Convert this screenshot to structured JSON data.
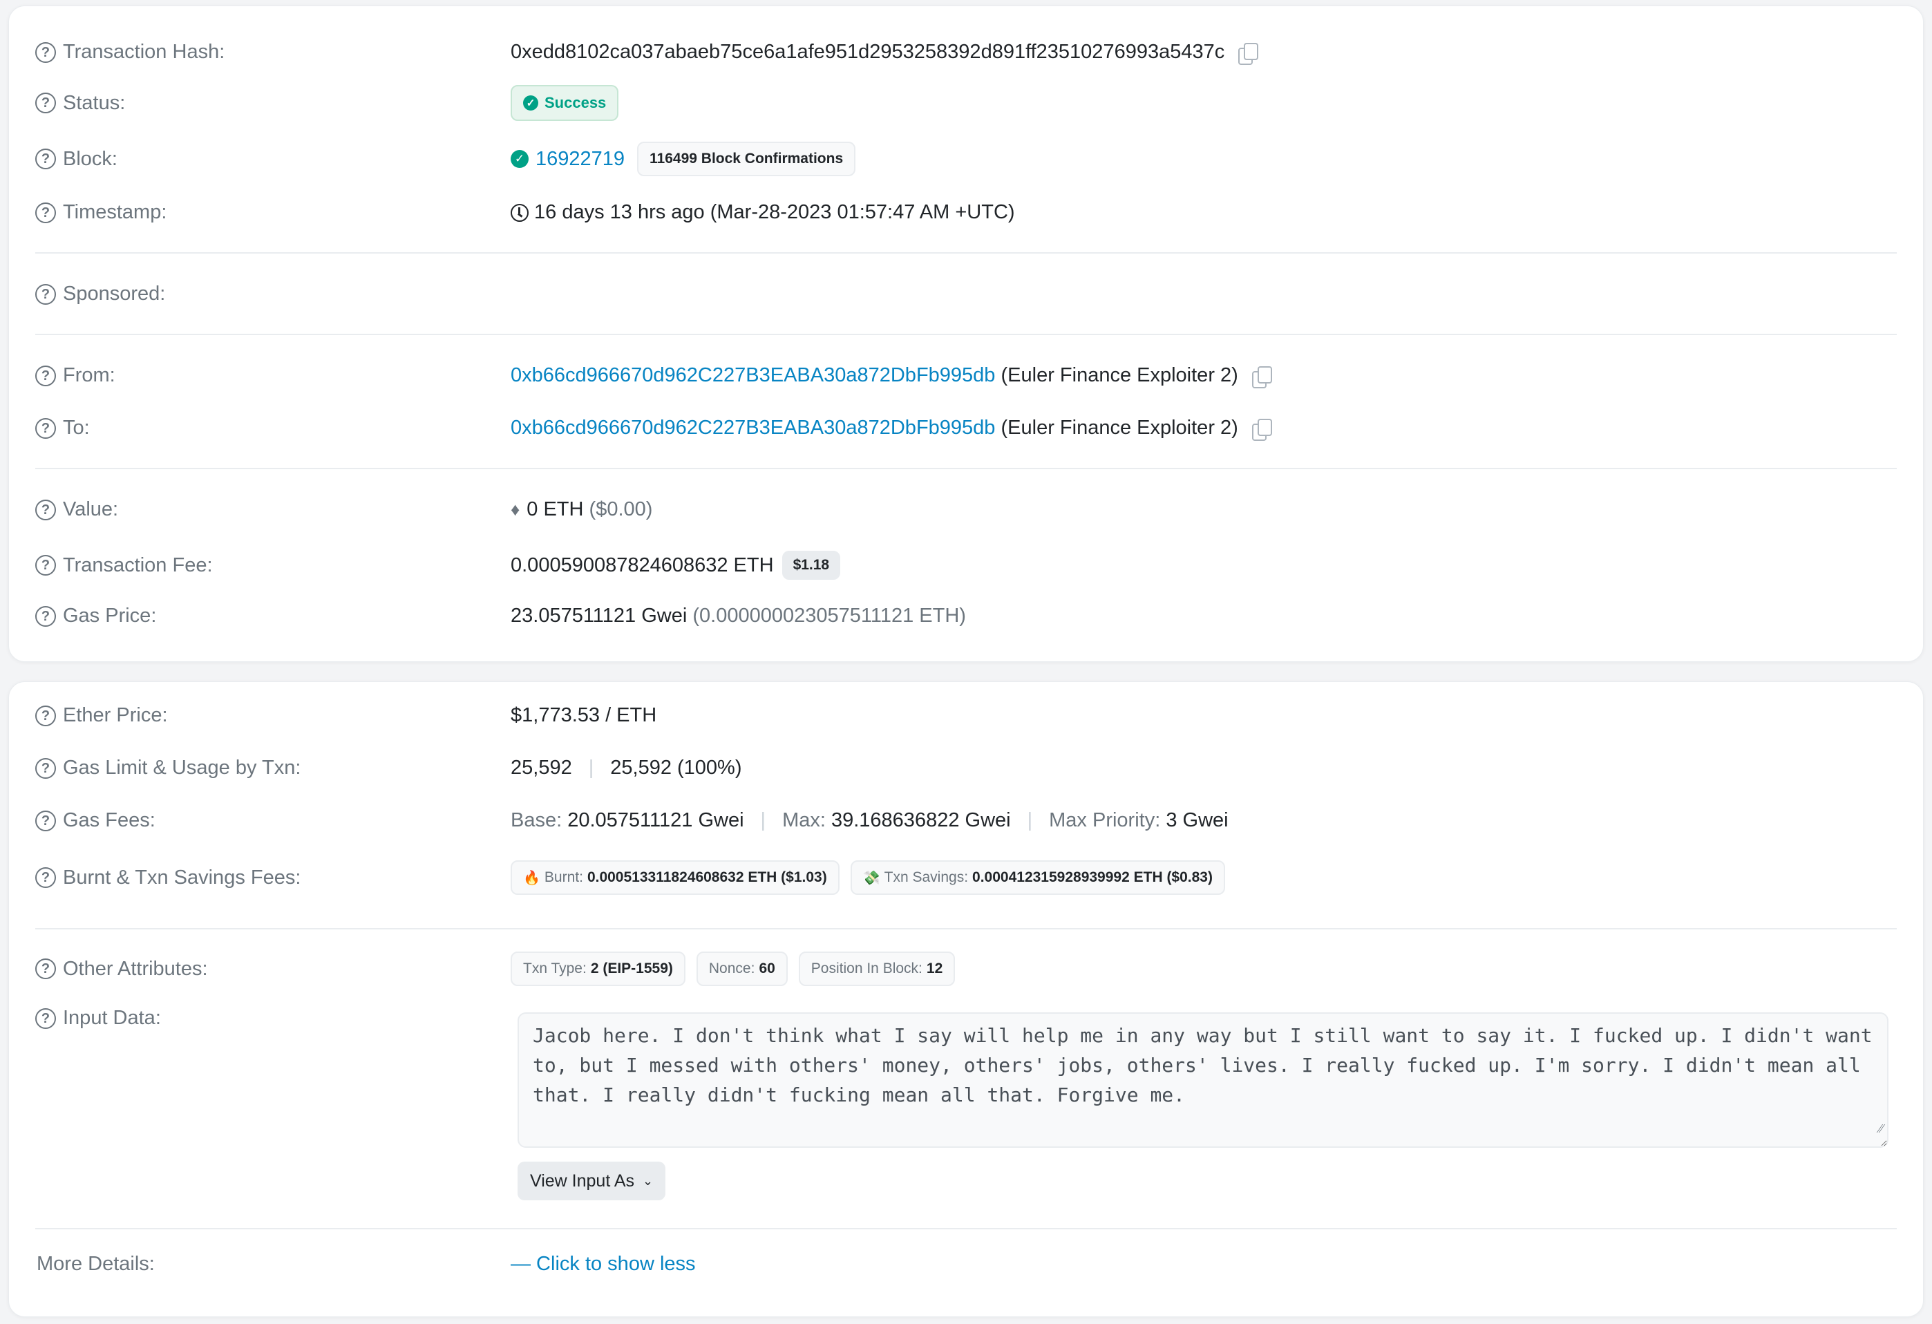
{
  "overview": {
    "tx_hash": {
      "label": "Transaction Hash:",
      "value": "0xedd8102ca037abaeb75ce6a1afe951d2953258392d891ff23510276993a5437c"
    },
    "status": {
      "label": "Status:",
      "value": "Success"
    },
    "block": {
      "label": "Block:",
      "number": "16922719",
      "confirmations": "116499 Block Confirmations"
    },
    "timestamp": {
      "label": "Timestamp:",
      "value": "16 days 13 hrs ago (Mar-28-2023 01:57:47 AM +UTC)"
    },
    "sponsored": {
      "label": "Sponsored:"
    },
    "from": {
      "label": "From:",
      "address": "0xb66cd966670d962C227B3EABA30a872DbFb995db",
      "name": "(Euler Finance Exploiter 2)"
    },
    "to": {
      "label": "To:",
      "address": "0xb66cd966670d962C227B3EABA30a872DbFb995db",
      "name": "(Euler Finance Exploiter 2)"
    },
    "value": {
      "label": "Value:",
      "amount": "0 ETH",
      "usd": "($0.00)"
    },
    "tx_fee": {
      "label": "Transaction Fee:",
      "amount": "0.000590087824608632 ETH",
      "usd": "$1.18"
    },
    "gas_price": {
      "label": "Gas Price:",
      "gwei": "23.057511121 Gwei",
      "eth": "(0.000000023057511121 ETH)"
    }
  },
  "more": {
    "ether_price": {
      "label": "Ether Price:",
      "value": "$1,773.53 / ETH"
    },
    "gas_limit": {
      "label": "Gas Limit & Usage by Txn:",
      "limit": "25,592",
      "usage": "25,592 (100%)"
    },
    "gas_fees": {
      "label": "Gas Fees:",
      "base_label": "Base:",
      "base": "20.057511121 Gwei",
      "max_label": "Max:",
      "max": "39.168636822 Gwei",
      "priority_label": "Max Priority:",
      "priority": "3 Gwei"
    },
    "burnt": {
      "label": "Burnt & Txn Savings Fees:",
      "burnt_label": "Burnt:",
      "burnt_value": "0.000513311824608632 ETH ($1.03)",
      "savings_label": "Txn Savings:",
      "savings_value": "0.000412315928939992 ETH ($0.83)"
    },
    "other": {
      "label": "Other Attributes:",
      "txn_type_label": "Txn Type:",
      "txn_type": "2 (EIP-1559)",
      "nonce_label": "Nonce:",
      "nonce": "60",
      "position_label": "Position In Block:",
      "position": "12"
    },
    "input_data": {
      "label": "Input Data:",
      "text": "Jacob here. I don't think what I say will help me in any way but I still want to say it. I fucked up. I didn't want to, but I messed with others' money, others' jobs, others' lives. I really fucked up. I'm sorry. I didn't mean all that. I really didn't fucking mean all that. Forgive me.",
      "view_button": "View Input As"
    },
    "more_details": {
      "label": "More Details:",
      "toggle": "— Click to show less"
    }
  }
}
